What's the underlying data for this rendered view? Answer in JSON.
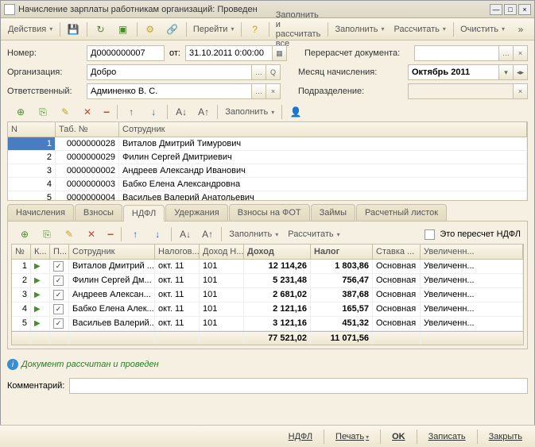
{
  "window": {
    "title": "Начисление зарплаты работникам организаций: Проведен"
  },
  "toolbar": {
    "actions": "Действия",
    "go": "Перейти",
    "fill_calc_all": "Заполнить и рассчитать все",
    "fill": "Заполнить",
    "calc": "Рассчитать",
    "clear": "Очистить"
  },
  "form": {
    "number_lbl": "Номер:",
    "number": "Д0000000007",
    "from_lbl": "от:",
    "date": "31.10.2011 0:00:00",
    "org_lbl": "Организация:",
    "org": "Добро",
    "resp_lbl": "Ответственный:",
    "resp": "Админенко В. С.",
    "recalc_lbl": "Перерасчет документа:",
    "recalc": "",
    "month_lbl": "Месяц начисления:",
    "month": "Октябрь 2011",
    "dept_lbl": "Подразделение:",
    "dept": ""
  },
  "subtool": {
    "fill": "Заполнить"
  },
  "grid1": {
    "headers": {
      "n": "N",
      "tab": "Таб. №",
      "emp": "Сотрудник"
    },
    "rows": [
      {
        "n": "1",
        "tab": "0000000028",
        "emp": "Виталов Дмитрий Тимурович"
      },
      {
        "n": "2",
        "tab": "0000000029",
        "emp": "Филин Сергей Дмитриевич"
      },
      {
        "n": "3",
        "tab": "0000000002",
        "emp": "Андреев Александр Иванович"
      },
      {
        "n": "4",
        "tab": "0000000003",
        "emp": "Бабко Елена Александровна"
      },
      {
        "n": "5",
        "tab": "0000000004",
        "emp": "Васильев Валерий Анатольевич"
      }
    ]
  },
  "tabs": {
    "t1": "Начисления",
    "t2": "Взносы",
    "t3": "НДФЛ",
    "t4": "Удержания",
    "t5": "Взносы на ФОТ",
    "t6": "Займы",
    "t7": "Расчетный листок"
  },
  "subtool2": {
    "fill": "Заполнить",
    "calc": "Рассчитать",
    "recalc_chk": "Это пересчет НДФЛ"
  },
  "grid2": {
    "headers": {
      "n": "№",
      "k": "К...",
      "p": "П...",
      "emp": "Сотрудник",
      "tax": "Налогов...",
      "incn": "Доход Н...",
      "inc": "Доход",
      "taxv": "Налог",
      "rate": "Ставка ...",
      "inc2": "Увеличенн..."
    },
    "rows": [
      {
        "n": "1",
        "emp": "Виталов Дмитрий ...",
        "per": "окт. 11",
        "code": "101",
        "inc": "12 114,26",
        "tax": "1 803,86",
        "rate": "Основная",
        "inc2": "Увеличенн..."
      },
      {
        "n": "2",
        "emp": "Филин Сергей Дм...",
        "per": "окт. 11",
        "code": "101",
        "inc": "5 231,48",
        "tax": "756,47",
        "rate": "Основная",
        "inc2": "Увеличенн..."
      },
      {
        "n": "3",
        "emp": "Андреев Алексан...",
        "per": "окт. 11",
        "code": "101",
        "inc": "2 681,02",
        "tax": "387,68",
        "rate": "Основная",
        "inc2": "Увеличенн..."
      },
      {
        "n": "4",
        "emp": "Бабко Елена Алек...",
        "per": "окт. 11",
        "code": "101",
        "inc": "2 121,16",
        "tax": "165,57",
        "rate": "Основная",
        "inc2": "Увеличенн..."
      },
      {
        "n": "5",
        "emp": "Васильев Валерий...",
        "per": "окт. 11",
        "code": "101",
        "inc": "3 121,16",
        "tax": "451,32",
        "rate": "Основная",
        "inc2": "Увеличенн..."
      }
    ],
    "totals": {
      "inc": "77 521,02",
      "tax": "11 071,56"
    }
  },
  "status": "Документ рассчитан и проведен",
  "comment_lbl": "Комментарий:",
  "comment": "",
  "bottom": {
    "ndfl": "НДФЛ",
    "print": "Печать",
    "ok": "OK",
    "save": "Записать",
    "close": "Закрыть"
  }
}
